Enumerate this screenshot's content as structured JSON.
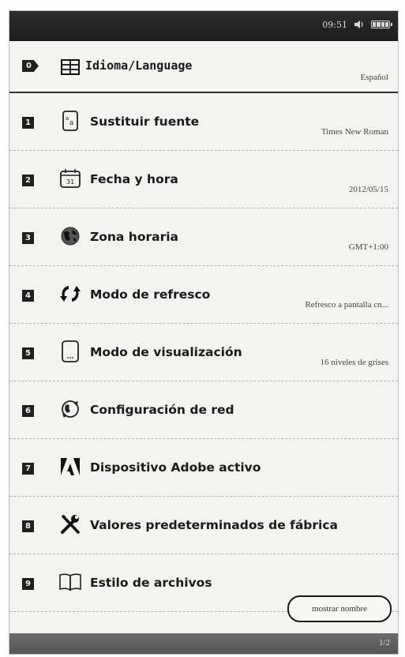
{
  "status": {
    "time": "09:51",
    "speaker_icon": "speaker-icon",
    "battery_icon": "battery-icon"
  },
  "settings": {
    "items": [
      {
        "key": "0",
        "label": "Idioma/Language",
        "value": "Español",
        "icon": "language-grid-icon"
      },
      {
        "key": "1",
        "label": "Sustituir fuente",
        "value": "Times New Roman",
        "icon": "font-icon"
      },
      {
        "key": "2",
        "label": "Fecha y hora",
        "value": "2012/05/15",
        "icon": "calendar-icon"
      },
      {
        "key": "3",
        "label": "Zona horaria",
        "value": "GMT+1:00",
        "icon": "globe-icon"
      },
      {
        "key": "4",
        "label": "Modo de refresco",
        "value": "Refresco a pantalla cn...",
        "icon": "refresh-icon"
      },
      {
        "key": "5",
        "label": "Modo de visualización",
        "value": "16 niveles de grises",
        "icon": "display-icon"
      },
      {
        "key": "6",
        "label": "Configuración de red",
        "value": "",
        "icon": "network-icon"
      },
      {
        "key": "7",
        "label": "Dispositivo Adobe activo",
        "value": "",
        "icon": "adobe-icon"
      },
      {
        "key": "8",
        "label": "Valores predeterminados de fábrica",
        "value": "",
        "icon": "tools-icon"
      },
      {
        "key": "9",
        "label": "Estilo de archivos",
        "value": "",
        "icon": "book-icon"
      }
    ],
    "file_style_option": "mostrar nombre"
  },
  "footer": {
    "page": "1/2"
  }
}
